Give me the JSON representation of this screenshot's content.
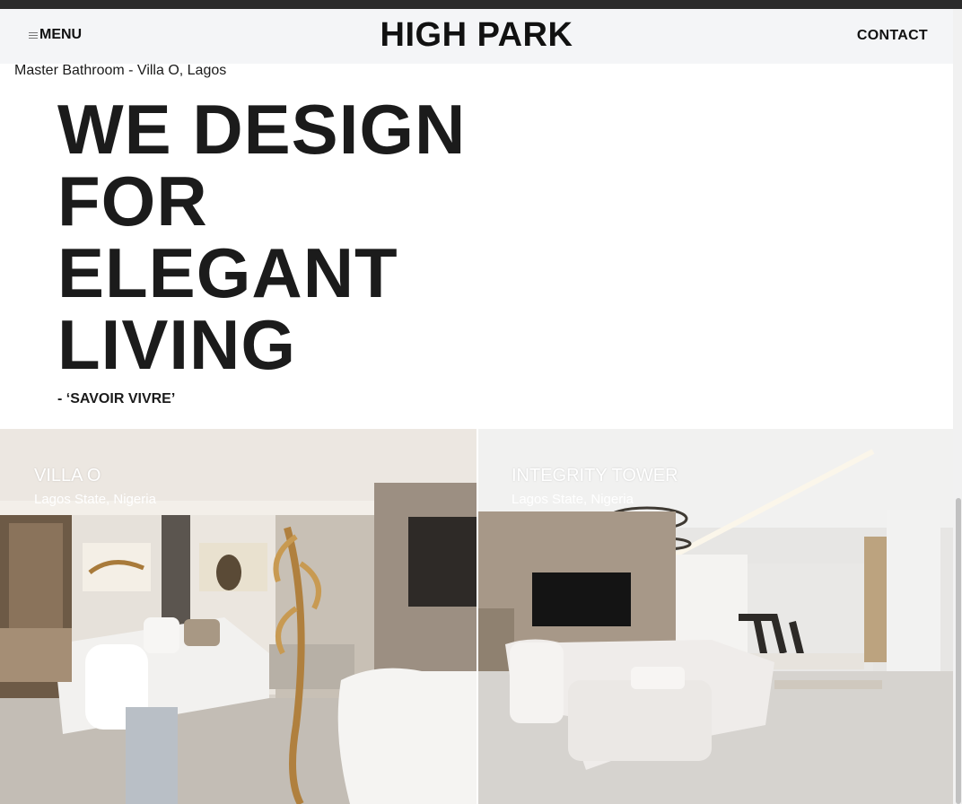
{
  "header": {
    "menu_label": "MENU",
    "brand": "HIGH PARK",
    "contact_label": "CONTACT"
  },
  "hero": {
    "caption": "Master Bathroom - Villa O, Lagos",
    "title_lines": [
      "WE DESIGN",
      "FOR",
      "ELEGANT",
      "LIVING"
    ],
    "tagline": "- ‘SAVOIR VIVRE’"
  },
  "projects": [
    {
      "name": "VILLA O",
      "location": "Lagos State, Nigeria"
    },
    {
      "name": "INTEGRITY TOWER",
      "location": "Lagos State, Nigeria"
    }
  ],
  "icons": {
    "menu": "hamburger-icon"
  }
}
